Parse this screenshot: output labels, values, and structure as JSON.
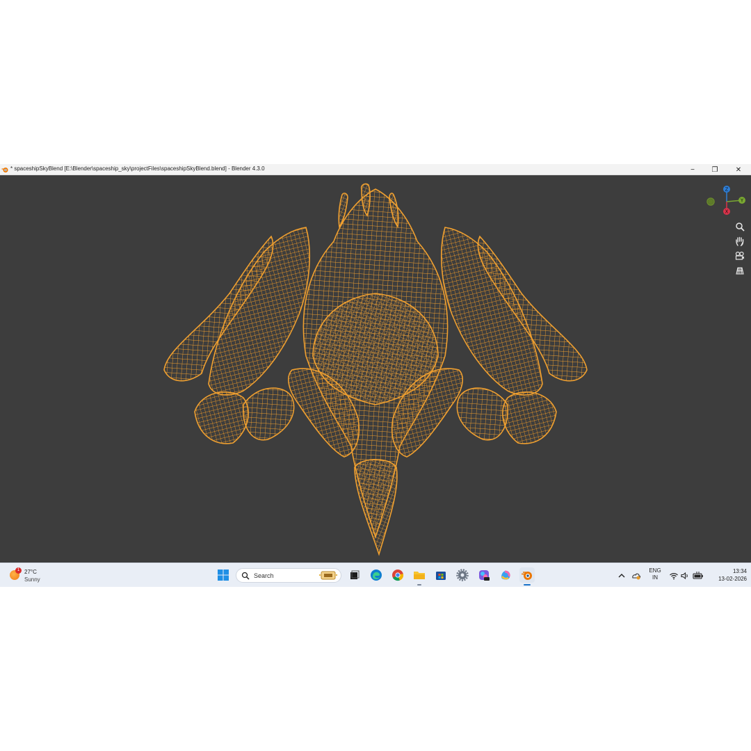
{
  "window": {
    "title": "* spaceshipSkyBlend [E:\\Blender\\spaceship_sky\\projectFiles\\spaceshipSkyBlend.blend] - Blender 4.3.0",
    "controls": {
      "minimize": "−",
      "maximize": "❐",
      "close": "✕"
    }
  },
  "viewport": {
    "background": "#3d3d3d",
    "wire_color": "#f0a030",
    "gizmo": {
      "z": "Z",
      "y": "Y",
      "x": "X"
    },
    "nav_tools": [
      "zoom-icon",
      "pan-hand-icon",
      "camera-icon",
      "grid-ortho-icon"
    ]
  },
  "taskbar": {
    "weather": {
      "temp": "27°C",
      "condition": "Sunny",
      "badge": "1"
    },
    "search": {
      "placeholder": "Search"
    },
    "apps": [
      "windows-start-icon",
      "task-view-icon",
      "edge-icon",
      "chrome-icon",
      "file-explorer-icon",
      "store-icon",
      "settings-icon",
      "copilot-pro-icon",
      "copilot-icon",
      "blender-icon"
    ],
    "tray": {
      "lang_top": "ENG",
      "lang_bottom": "IN",
      "time": "13:34",
      "date": "13-02-2026"
    }
  }
}
